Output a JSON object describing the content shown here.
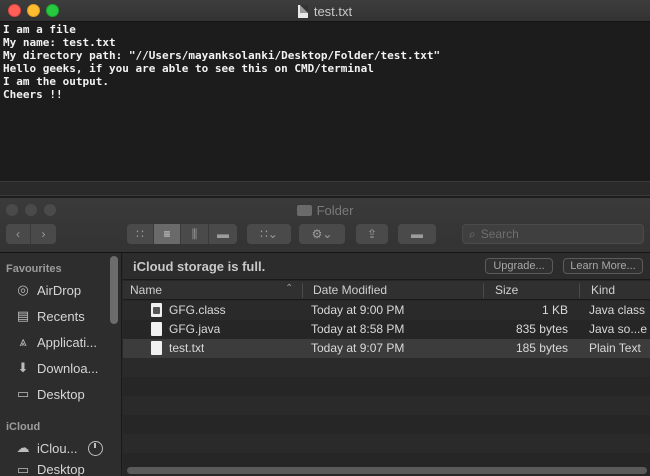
{
  "editor": {
    "title": "test.txt",
    "lines": [
      "I am a file",
      "My name: test.txt",
      "My directory path: \"//Users/mayanksolanki/Desktop/Folder/test.txt\"",
      "Hello geeks, if you are able to see this on CMD/terminal",
      "I am the output.",
      "Cheers !!"
    ]
  },
  "finder": {
    "title": "Folder",
    "search_placeholder": "Search",
    "sidebar": {
      "sections": [
        {
          "label": "Favourites"
        },
        {
          "label": "iCloud"
        }
      ],
      "items": [
        {
          "label": "AirDrop",
          "icon": "airdrop-icon"
        },
        {
          "label": "Recents",
          "icon": "recents-icon"
        },
        {
          "label": "Applicati...",
          "icon": "applications-icon"
        },
        {
          "label": "Downloa...",
          "icon": "downloads-icon"
        },
        {
          "label": "Desktop",
          "icon": "desktop-icon"
        },
        {
          "label": "iClou...",
          "icon": "icloud-drive-icon"
        },
        {
          "label": "Desktop",
          "icon": "desktop-icon"
        }
      ]
    },
    "storage": {
      "message": "iCloud storage is full.",
      "upgrade_label": "Upgrade...",
      "learn_more_label": "Learn More..."
    },
    "columns": {
      "name": "Name",
      "date": "Date Modified",
      "size": "Size",
      "kind": "Kind"
    },
    "files": [
      {
        "name": "GFG.class",
        "date": "Today at 9:00 PM",
        "size": "1 KB",
        "kind": "Java class",
        "icon": "class-file-icon"
      },
      {
        "name": "GFG.java",
        "date": "Today at 8:58 PM",
        "size": "835 bytes",
        "kind": "Java so...e",
        "icon": "java-file-icon"
      },
      {
        "name": "test.txt",
        "date": "Today at 9:07 PM",
        "size": "185 bytes",
        "kind": "Plain Text",
        "icon": "text-file-icon"
      }
    ]
  }
}
